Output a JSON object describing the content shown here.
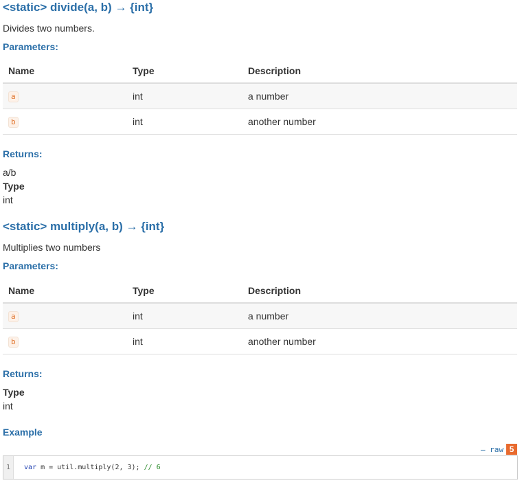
{
  "methods": [
    {
      "signature": "<static> divide(a, b) → {int}",
      "description": "Divides two numbers.",
      "parameters_label": "Parameters:",
      "columns": [
        "Name",
        "Type",
        "Description"
      ],
      "params": [
        {
          "name": "a",
          "type": "int",
          "description": "a number"
        },
        {
          "name": "b",
          "type": "int",
          "description": "another number"
        }
      ],
      "returns_label": "Returns:",
      "returns_value": "a/b",
      "type_label": "Type",
      "type_value": "int"
    },
    {
      "signature": "<static> multiply(a, b) → {int}",
      "description": "Multiplies two numbers",
      "parameters_label": "Parameters:",
      "columns": [
        "Name",
        "Type",
        "Description"
      ],
      "params": [
        {
          "name": "a",
          "type": "int",
          "description": "a number"
        },
        {
          "name": "b",
          "type": "int",
          "description": "another number"
        }
      ],
      "returns_label": "Returns:",
      "type_label": "Type",
      "type_value": "int",
      "example_label": "Example"
    }
  ],
  "code": {
    "toolbar_raw": "– raw",
    "badge_icon": "html5-icon",
    "badge_text": "5",
    "line_number": "1",
    "keyword": "var",
    "statement": " m = util.multiply(2, 3); ",
    "comment": "// 6"
  },
  "colors": {
    "link_blue": "#2b6fa8",
    "param_orange": "#e0742c",
    "html5_orange": "#e86a2e"
  }
}
